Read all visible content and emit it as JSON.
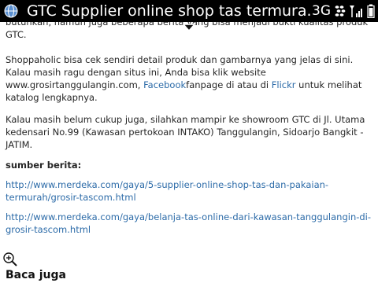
{
  "status_bar": {
    "title": "GTC Supplier online shop tas termura...",
    "network": "3G",
    "app_icon": "browser-globe-icon",
    "bbm_icon": "blackberry-icon",
    "signal_icon": "signal-strength-icon",
    "battery_icon": "battery-icon"
  },
  "article": {
    "cut_line_1": "butuhkan, namun juga beberapa berita yang bisa menjadi bukti kualitas produk",
    "cut_line_2": "GTC.",
    "para1_start": "Shoppaholic bisa cek sendiri detail produk dan gambarnya yang jelas di sini. Kalau masih ragu dengan situs ini, Anda bisa klik website www.grosirtanggulangin.com, ",
    "facebook_link": "Facebook",
    "para1_mid": "fanpage di atau di ",
    "flickr_link": "Flickr",
    "para1_end": " untuk melihat katalog lengkapnya.",
    "para2": "Kalau masih belum cukup juga, silahkan mampir ke showroom GTC di Jl. Utama kedensari No.99 (Kawasan pertokoan INTAKO) Tanggulangin, Sidoarjo Bangkit - JATIM.",
    "source_label": "sumber berita:",
    "source_link_1": "http://www.merdeka.com/gaya/5-supplier-online-shop-tas-dan-pakaian-termurah/grosir-tascom.html",
    "source_link_2": "http://www.merdeka.com/gaya/belanja-tas-online-dari-kawasan-tanggulangin-di-grosir-tascom.html"
  },
  "footer": {
    "zoom_icon": "zoom-in-icon",
    "heading": "Baca juga"
  }
}
